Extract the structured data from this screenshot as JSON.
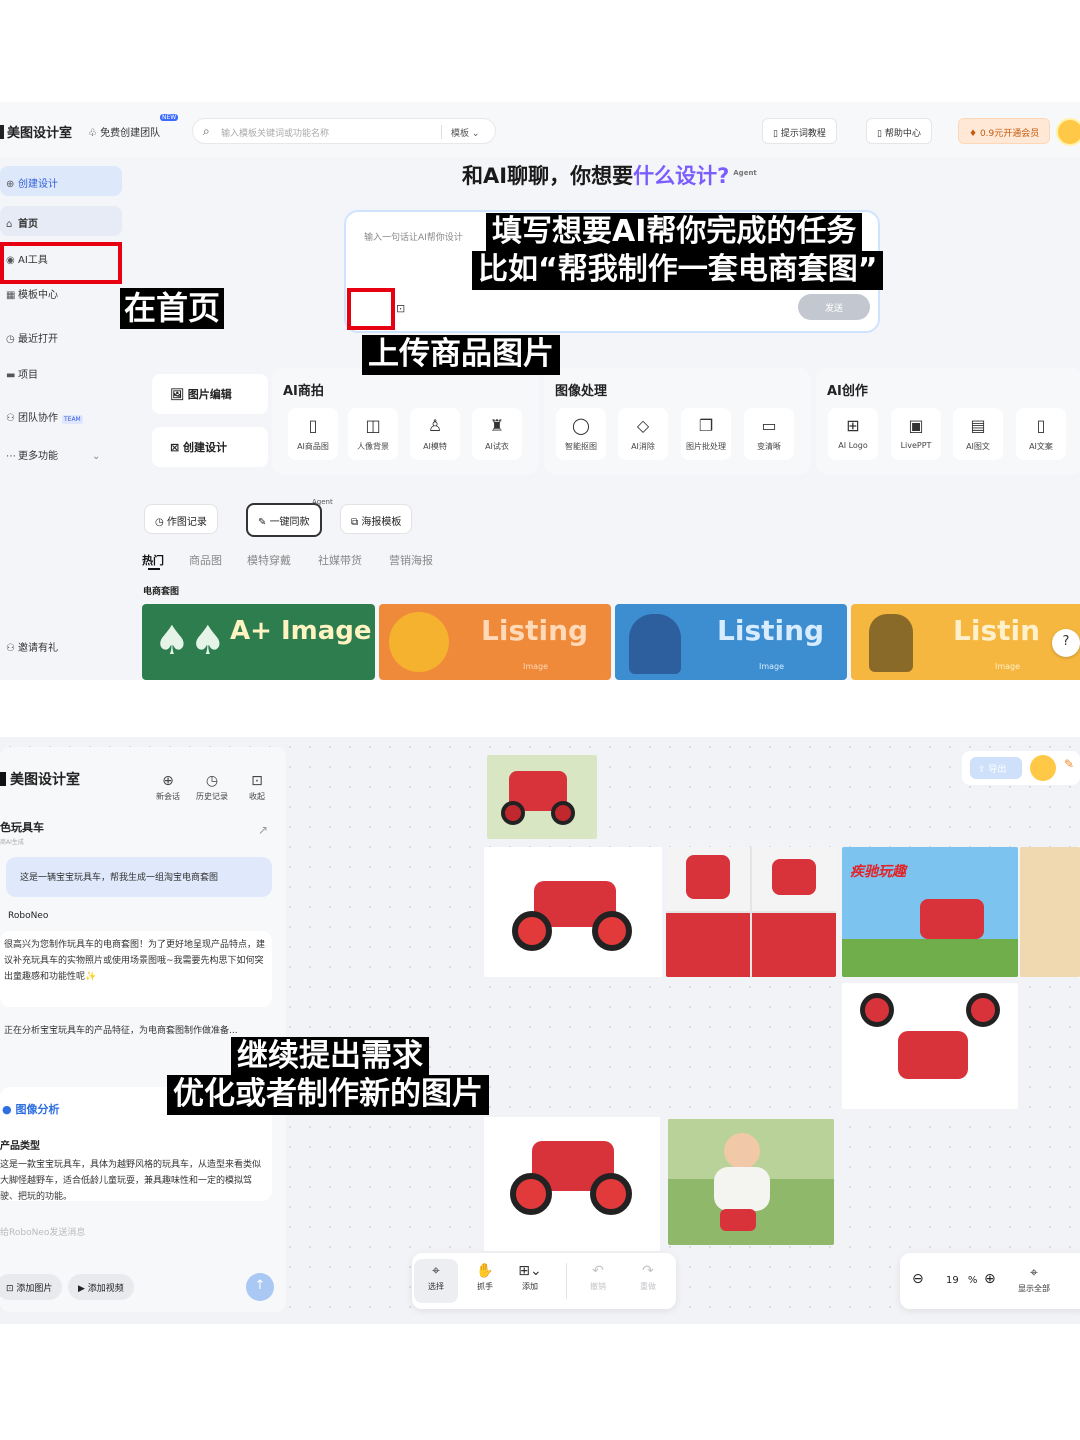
{
  "top": {
    "logo": "美图设计室",
    "team_link": "免费创建团队",
    "new_badge": "NEW",
    "search_placeholder": "输入模板关键词或功能名称",
    "search_scope": "模板",
    "prompt_tutorial": "提示词教程",
    "help_center": "帮助中心",
    "vip": "0.9元开通会员"
  },
  "sidebar": {
    "create": "创建设计",
    "home": "首页",
    "ai_tools": "AI工具",
    "templates": "模板中心",
    "recent": "最近打开",
    "projects": "项目",
    "team": "团队协作",
    "team_badge": "TEAM",
    "more": "更多功能",
    "invite": "邀请有礼"
  },
  "hero": {
    "heading_a": "和AI聊聊，你想要",
    "heading_b": "什么设计?",
    "agent": "Agent",
    "placeholder": "输入一句话让AI帮你设计",
    "send": "发送"
  },
  "captions": {
    "home": "在首页",
    "task_line1": "填写想要AI帮你完成的任务",
    "task_line2": "比如“帮我制作一套电商套图”",
    "upload": "上传商品图片",
    "continue_line1": "继续提出需求",
    "continue_line2": "优化或者制作新的图片"
  },
  "tools": {
    "image_edit": "图片编辑",
    "create_design": "创建设计",
    "groups": [
      {
        "title": "AI商拍",
        "items": [
          "AI商品图",
          "人像背景",
          "AI模特",
          "AI试衣"
        ]
      },
      {
        "title": "图像处理",
        "items": [
          "智能抠图",
          "AI消除",
          "图片批处理",
          "变清晰"
        ]
      },
      {
        "title": "AI创作",
        "items": [
          "AI Logo",
          "LivePPT",
          "AI图文",
          "AI文案"
        ]
      }
    ]
  },
  "chips": {
    "history": "作图记录",
    "one_click": "一键同款",
    "agent": "Agent",
    "poster": "海报模板"
  },
  "tabs": [
    "热门",
    "商品图",
    "模特穿戴",
    "社媒带货",
    "营销海报"
  ],
  "section_title": "电商套图",
  "tiles": [
    {
      "label": "A+ Image",
      "sub": "",
      "color": "#2e7d4f"
    },
    {
      "label": "Listing",
      "sub": "Image",
      "color": "#ef8a3a"
    },
    {
      "label": "Listing",
      "sub": "Image",
      "color": "#3d8ed1"
    },
    {
      "label": "Listin",
      "sub": "Image",
      "color": "#f5b73f"
    }
  ],
  "help": "?",
  "workspace": {
    "logo": "美图设计室",
    "new_chat": "新会话",
    "history": "历史记录",
    "collapse": "收起",
    "title": "色玩具车",
    "subtitle": "商AI生成",
    "user_msg": "这是一辆宝宝玩具车，帮我生成一组淘宝电商套图",
    "bot_name": "RoboNeo",
    "bot_msg1": "很高兴为您制作玩具车的电商套图！为了更好地呈现产品特点，建议补充玩具车的实物照片或使用场景图哦~我需要先构思下如何突出童趣感和功能性呢✨",
    "bot_msg2": "正在分析宝宝玩具车的产品特征，为电商套图制作做准备...",
    "analysis_title": "图像分析",
    "product_type": "产品类型",
    "analysis_body": "这是一款宝宝玩具车，具体为越野风格的玩具车，从造型来看类似大脚怪越野车，适合低龄儿童玩耍，兼具趣味性和一定的模拟驾驶、把玩的功能。",
    "input_placeholder": "给RoboNeo发送消息",
    "add_image": "添加图片",
    "add_video": "添加视频",
    "export": "导出",
    "canvas_label": "疾驰玩趣",
    "toolbar": [
      "选择",
      "抓手",
      "添加",
      "撤销",
      "重做"
    ],
    "zoom_value": "19",
    "zoom_unit": "%",
    "show_all": "显示全部"
  }
}
